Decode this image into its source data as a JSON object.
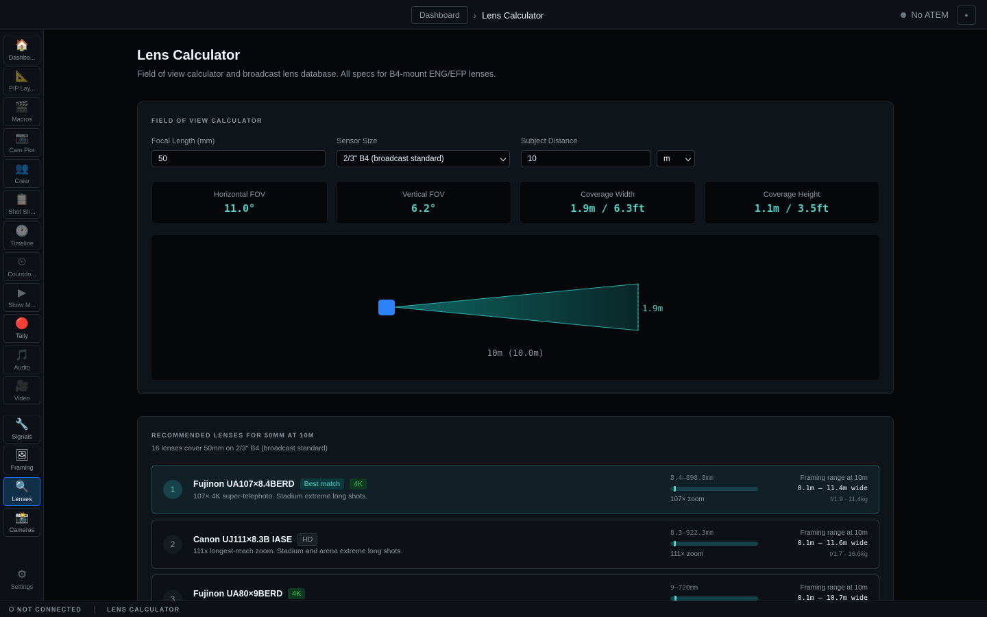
{
  "topbar": {
    "breadcrumb_root": "Dashboard",
    "breadcrumb_separator": "›",
    "breadcrumb_current": "Lens Calculator",
    "atem_status": "No ATEM"
  },
  "sidebar": {
    "items": [
      {
        "label": "Dashbo...",
        "icon": "🏠"
      },
      {
        "label": "PIP Lay...",
        "icon": "📐"
      },
      {
        "label": "Macros",
        "icon": "🎬"
      },
      {
        "label": "Cam Plot",
        "icon": "📷"
      },
      {
        "label": "Crew",
        "icon": "👥"
      },
      {
        "label": "Shot Sh...",
        "icon": "📋"
      },
      {
        "label": "Timeline",
        "icon": "🕐"
      },
      {
        "label": "Countdo...",
        "icon": "⏲"
      },
      {
        "label": "Show M...",
        "icon": "▶"
      },
      {
        "label": "Tally",
        "icon": "🔴"
      },
      {
        "label": "Audio",
        "icon": "🎵"
      },
      {
        "label": "Video",
        "icon": "🎥"
      },
      {
        "label": "Signals",
        "icon": "🔧"
      },
      {
        "label": "Framing",
        "icon": "🖼"
      },
      {
        "label": "Lenses",
        "icon": "🔍"
      },
      {
        "label": "Cameras",
        "icon": "📸"
      },
      {
        "label": "Settings",
        "icon": "⚙"
      }
    ]
  },
  "page": {
    "title": "Lens Calculator",
    "subtitle": "Field of view calculator and broadcast lens database. All specs for B4-mount ENG/EFP lenses."
  },
  "fov": {
    "section_title": "Field of View Calculator",
    "focal_label": "Focal Length (mm)",
    "focal_value": "50",
    "sensor_label": "Sensor Size",
    "sensor_value": "2/3\" B4 (broadcast standard)",
    "distance_label": "Subject Distance",
    "distance_value": "10",
    "unit_value": "m",
    "stats": [
      {
        "label": "Horizontal FOV",
        "value": "11.0°"
      },
      {
        "label": "Vertical FOV",
        "value": "6.2°"
      },
      {
        "label": "Coverage Width",
        "value": "1.9m / 6.3ft"
      },
      {
        "label": "Coverage Height",
        "value": "1.1m / 3.5ft"
      }
    ],
    "viz": {
      "width_label": "1.9m",
      "distance_label": "10m (10.0m)",
      "horizontal_fov_deg": 11.0
    }
  },
  "recommended": {
    "section_title": "Recommended lenses for 50mm at 10m",
    "summary": "16 lenses cover 50mm on 2/3\" B4 (broadcast standard)",
    "framing_head": "Framing range at 10m",
    "lenses": [
      {
        "rank": "1",
        "name": "Fujinon UA107×8.4BERD",
        "badges": [
          {
            "text": "Best match",
            "type": "best"
          },
          {
            "text": "4K",
            "type": "4k"
          }
        ],
        "desc": "107× 4K super-telephoto. Stadium extreme long shots.",
        "range": "8.4–898.8mm",
        "zoom": "107× zoom",
        "framing": "0.1m – 11.4m wide",
        "spec": "f/1.9 · 11.4kg",
        "focal_position": 0.046
      },
      {
        "rank": "2",
        "name": "Canon UJ111×8.3B IASE",
        "badges": [
          {
            "text": "HD",
            "type": "hd"
          }
        ],
        "desc": "111x longest-reach zoom. Stadium and arena extreme long shots.",
        "range": "8.3–922.3mm",
        "zoom": "111× zoom",
        "framing": "0.1m – 11.6m wide",
        "spec": "f/1.7 · 16.6kg",
        "focal_position": 0.045
      },
      {
        "rank": "3",
        "name": "Fujinon UA80×9BERD",
        "badges": [
          {
            "text": "4K",
            "type": "4k"
          }
        ],
        "desc": "",
        "range": "9–720mm",
        "zoom": "",
        "framing": "0.1m – 10.7m wide",
        "spec": "",
        "focal_position": 0.058
      }
    ]
  },
  "statusbar": {
    "connection": "NOT CONNECTED",
    "page": "LENS CALCULATOR"
  }
}
